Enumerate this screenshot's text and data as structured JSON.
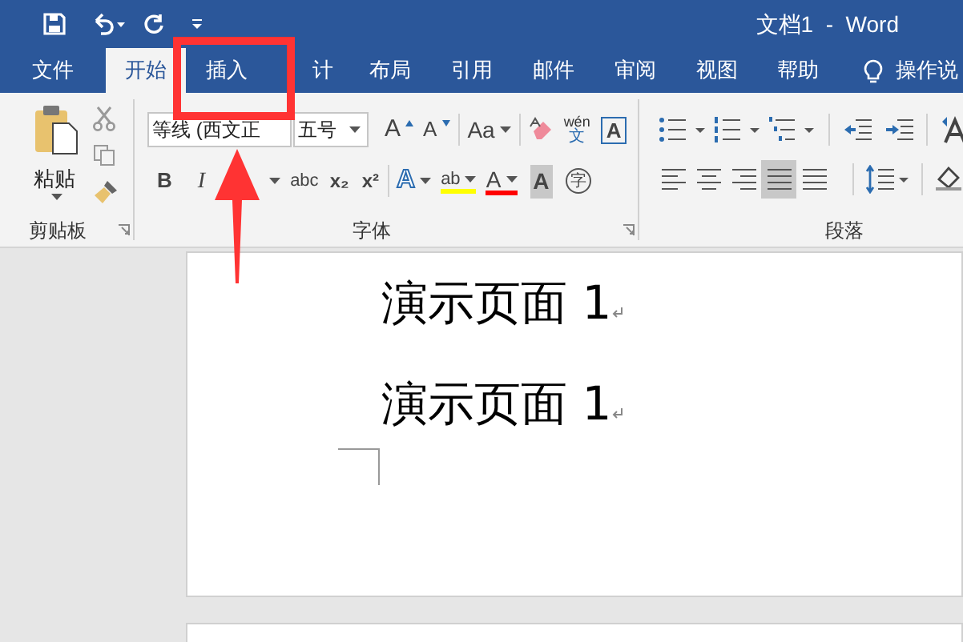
{
  "window": {
    "title": "文档1  -  Word"
  },
  "tabs": [
    {
      "label": "文件",
      "selected": false
    },
    {
      "label": "开始",
      "selected": true
    },
    {
      "label": "插入",
      "selected": false
    },
    {
      "label": "计",
      "selected": false
    },
    {
      "label": "布局",
      "selected": false
    },
    {
      "label": "引用",
      "selected": false
    },
    {
      "label": "邮件",
      "selected": false
    },
    {
      "label": "审阅",
      "selected": false
    },
    {
      "label": "视图",
      "selected": false
    },
    {
      "label": "帮助",
      "selected": false
    }
  ],
  "tell_me": "操作说",
  "clipboard": {
    "paste": "粘贴",
    "label": "剪贴板"
  },
  "font": {
    "name": "等线 (西文正",
    "size": "五号",
    "label": "字体",
    "row_1": [
      "A",
      "A",
      "Aa",
      "wén",
      "文",
      "A"
    ],
    "row_2": [
      "B",
      "I",
      "abc",
      "x₂",
      "x²",
      "A",
      "ab",
      "A",
      "A",
      "字"
    ]
  },
  "paragraph": {
    "label": "段落",
    "alignments": [
      {
        "selected": false
      },
      {
        "selected": false
      },
      {
        "selected": false
      },
      {
        "selected": true
      },
      {
        "selected": false
      }
    ]
  },
  "document": {
    "paragraphs": [
      "演示页面 1",
      "演示页面 1"
    ]
  }
}
